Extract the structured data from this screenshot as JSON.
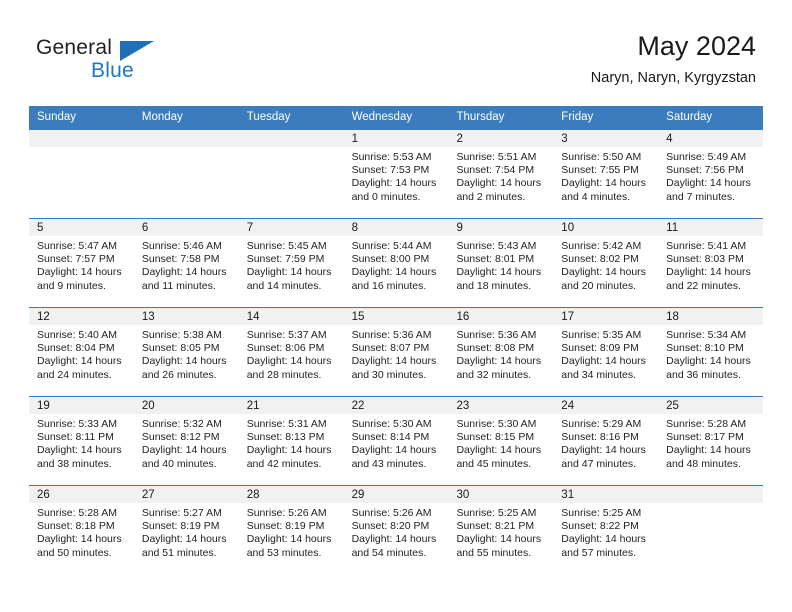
{
  "brand": {
    "name_top": "General",
    "name_bottom": "Blue"
  },
  "header": {
    "title": "May 2024",
    "location": "Naryn, Naryn, Kyrgyzstan"
  },
  "colors": {
    "header_blue": "#3a7cbe",
    "logo_blue": "#1878c6",
    "date_band": "#f1f1f1"
  },
  "weekdays": [
    "Sunday",
    "Monday",
    "Tuesday",
    "Wednesday",
    "Thursday",
    "Friday",
    "Saturday"
  ],
  "weeks": [
    [
      {
        "day": "",
        "sunrise": "",
        "sunset": "",
        "daylight_line1": "",
        "daylight_line2": ""
      },
      {
        "day": "",
        "sunrise": "",
        "sunset": "",
        "daylight_line1": "",
        "daylight_line2": ""
      },
      {
        "day": "",
        "sunrise": "",
        "sunset": "",
        "daylight_line1": "",
        "daylight_line2": ""
      },
      {
        "day": "1",
        "sunrise": "Sunrise: 5:53 AM",
        "sunset": "Sunset: 7:53 PM",
        "daylight_line1": "Daylight: 14 hours",
        "daylight_line2": "and 0 minutes."
      },
      {
        "day": "2",
        "sunrise": "Sunrise: 5:51 AM",
        "sunset": "Sunset: 7:54 PM",
        "daylight_line1": "Daylight: 14 hours",
        "daylight_line2": "and 2 minutes."
      },
      {
        "day": "3",
        "sunrise": "Sunrise: 5:50 AM",
        "sunset": "Sunset: 7:55 PM",
        "daylight_line1": "Daylight: 14 hours",
        "daylight_line2": "and 4 minutes."
      },
      {
        "day": "4",
        "sunrise": "Sunrise: 5:49 AM",
        "sunset": "Sunset: 7:56 PM",
        "daylight_line1": "Daylight: 14 hours",
        "daylight_line2": "and 7 minutes."
      }
    ],
    [
      {
        "day": "5",
        "sunrise": "Sunrise: 5:47 AM",
        "sunset": "Sunset: 7:57 PM",
        "daylight_line1": "Daylight: 14 hours",
        "daylight_line2": "and 9 minutes."
      },
      {
        "day": "6",
        "sunrise": "Sunrise: 5:46 AM",
        "sunset": "Sunset: 7:58 PM",
        "daylight_line1": "Daylight: 14 hours",
        "daylight_line2": "and 11 minutes."
      },
      {
        "day": "7",
        "sunrise": "Sunrise: 5:45 AM",
        "sunset": "Sunset: 7:59 PM",
        "daylight_line1": "Daylight: 14 hours",
        "daylight_line2": "and 14 minutes."
      },
      {
        "day": "8",
        "sunrise": "Sunrise: 5:44 AM",
        "sunset": "Sunset: 8:00 PM",
        "daylight_line1": "Daylight: 14 hours",
        "daylight_line2": "and 16 minutes."
      },
      {
        "day": "9",
        "sunrise": "Sunrise: 5:43 AM",
        "sunset": "Sunset: 8:01 PM",
        "daylight_line1": "Daylight: 14 hours",
        "daylight_line2": "and 18 minutes."
      },
      {
        "day": "10",
        "sunrise": "Sunrise: 5:42 AM",
        "sunset": "Sunset: 8:02 PM",
        "daylight_line1": "Daylight: 14 hours",
        "daylight_line2": "and 20 minutes."
      },
      {
        "day": "11",
        "sunrise": "Sunrise: 5:41 AM",
        "sunset": "Sunset: 8:03 PM",
        "daylight_line1": "Daylight: 14 hours",
        "daylight_line2": "and 22 minutes."
      }
    ],
    [
      {
        "day": "12",
        "sunrise": "Sunrise: 5:40 AM",
        "sunset": "Sunset: 8:04 PM",
        "daylight_line1": "Daylight: 14 hours",
        "daylight_line2": "and 24 minutes."
      },
      {
        "day": "13",
        "sunrise": "Sunrise: 5:38 AM",
        "sunset": "Sunset: 8:05 PM",
        "daylight_line1": "Daylight: 14 hours",
        "daylight_line2": "and 26 minutes."
      },
      {
        "day": "14",
        "sunrise": "Sunrise: 5:37 AM",
        "sunset": "Sunset: 8:06 PM",
        "daylight_line1": "Daylight: 14 hours",
        "daylight_line2": "and 28 minutes."
      },
      {
        "day": "15",
        "sunrise": "Sunrise: 5:36 AM",
        "sunset": "Sunset: 8:07 PM",
        "daylight_line1": "Daylight: 14 hours",
        "daylight_line2": "and 30 minutes."
      },
      {
        "day": "16",
        "sunrise": "Sunrise: 5:36 AM",
        "sunset": "Sunset: 8:08 PM",
        "daylight_line1": "Daylight: 14 hours",
        "daylight_line2": "and 32 minutes."
      },
      {
        "day": "17",
        "sunrise": "Sunrise: 5:35 AM",
        "sunset": "Sunset: 8:09 PM",
        "daylight_line1": "Daylight: 14 hours",
        "daylight_line2": "and 34 minutes."
      },
      {
        "day": "18",
        "sunrise": "Sunrise: 5:34 AM",
        "sunset": "Sunset: 8:10 PM",
        "daylight_line1": "Daylight: 14 hours",
        "daylight_line2": "and 36 minutes."
      }
    ],
    [
      {
        "day": "19",
        "sunrise": "Sunrise: 5:33 AM",
        "sunset": "Sunset: 8:11 PM",
        "daylight_line1": "Daylight: 14 hours",
        "daylight_line2": "and 38 minutes."
      },
      {
        "day": "20",
        "sunrise": "Sunrise: 5:32 AM",
        "sunset": "Sunset: 8:12 PM",
        "daylight_line1": "Daylight: 14 hours",
        "daylight_line2": "and 40 minutes."
      },
      {
        "day": "21",
        "sunrise": "Sunrise: 5:31 AM",
        "sunset": "Sunset: 8:13 PM",
        "daylight_line1": "Daylight: 14 hours",
        "daylight_line2": "and 42 minutes."
      },
      {
        "day": "22",
        "sunrise": "Sunrise: 5:30 AM",
        "sunset": "Sunset: 8:14 PM",
        "daylight_line1": "Daylight: 14 hours",
        "daylight_line2": "and 43 minutes."
      },
      {
        "day": "23",
        "sunrise": "Sunrise: 5:30 AM",
        "sunset": "Sunset: 8:15 PM",
        "daylight_line1": "Daylight: 14 hours",
        "daylight_line2": "and 45 minutes."
      },
      {
        "day": "24",
        "sunrise": "Sunrise: 5:29 AM",
        "sunset": "Sunset: 8:16 PM",
        "daylight_line1": "Daylight: 14 hours",
        "daylight_line2": "and 47 minutes."
      },
      {
        "day": "25",
        "sunrise": "Sunrise: 5:28 AM",
        "sunset": "Sunset: 8:17 PM",
        "daylight_line1": "Daylight: 14 hours",
        "daylight_line2": "and 48 minutes."
      }
    ],
    [
      {
        "day": "26",
        "sunrise": "Sunrise: 5:28 AM",
        "sunset": "Sunset: 8:18 PM",
        "daylight_line1": "Daylight: 14 hours",
        "daylight_line2": "and 50 minutes."
      },
      {
        "day": "27",
        "sunrise": "Sunrise: 5:27 AM",
        "sunset": "Sunset: 8:19 PM",
        "daylight_line1": "Daylight: 14 hours",
        "daylight_line2": "and 51 minutes."
      },
      {
        "day": "28",
        "sunrise": "Sunrise: 5:26 AM",
        "sunset": "Sunset: 8:19 PM",
        "daylight_line1": "Daylight: 14 hours",
        "daylight_line2": "and 53 minutes."
      },
      {
        "day": "29",
        "sunrise": "Sunrise: 5:26 AM",
        "sunset": "Sunset: 8:20 PM",
        "daylight_line1": "Daylight: 14 hours",
        "daylight_line2": "and 54 minutes."
      },
      {
        "day": "30",
        "sunrise": "Sunrise: 5:25 AM",
        "sunset": "Sunset: 8:21 PM",
        "daylight_line1": "Daylight: 14 hours",
        "daylight_line2": "and 55 minutes."
      },
      {
        "day": "31",
        "sunrise": "Sunrise: 5:25 AM",
        "sunset": "Sunset: 8:22 PM",
        "daylight_line1": "Daylight: 14 hours",
        "daylight_line2": "and 57 minutes."
      },
      {
        "day": "",
        "sunrise": "",
        "sunset": "",
        "daylight_line1": "",
        "daylight_line2": ""
      }
    ]
  ]
}
